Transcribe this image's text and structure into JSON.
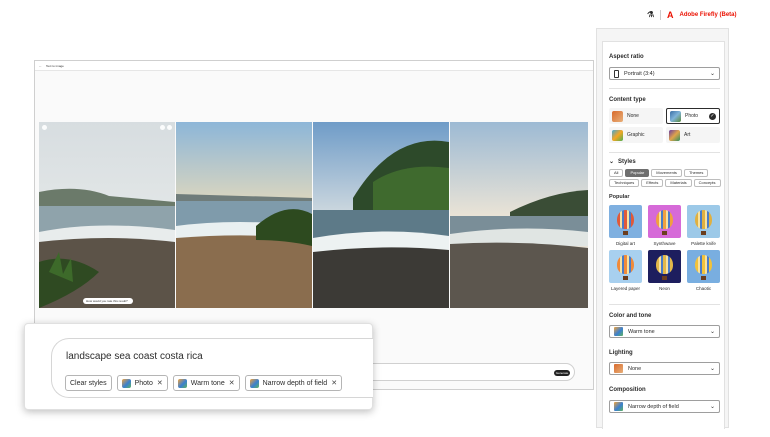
{
  "brand": {
    "name": "Adobe Firefly (Beta)",
    "accent": "#eb1000"
  },
  "topline": {
    "back": "Text to image"
  },
  "gallery": {
    "rating_text": "How would you rate this result?"
  },
  "bottom": {
    "generate": "Generate"
  },
  "prompt": {
    "text": "landscape sea coast costa rica",
    "chips": [
      {
        "label": "Clear styles",
        "thumb": false
      },
      {
        "label": "Photo",
        "thumb": true
      },
      {
        "label": "Warm tone",
        "thumb": true
      },
      {
        "label": "Narrow depth of field",
        "thumb": true
      }
    ]
  },
  "panel": {
    "aspect_ratio": {
      "title": "Aspect ratio",
      "value": "Portrait (3:4)"
    },
    "content_type": {
      "title": "Content type",
      "options": [
        {
          "label": "None",
          "icon": "none"
        },
        {
          "label": "Photo",
          "icon": "photo",
          "selected": true
        },
        {
          "label": "Graphic",
          "icon": "graphic"
        },
        {
          "label": "Art",
          "icon": "art"
        }
      ]
    },
    "styles": {
      "title": "Styles",
      "tabs": [
        {
          "label": "All"
        },
        {
          "label": "Popular",
          "active": true
        },
        {
          "label": "Movements"
        },
        {
          "label": "Themes"
        },
        {
          "label": "Techniques"
        },
        {
          "label": "Effects"
        },
        {
          "label": "Materials"
        },
        {
          "label": "Concepts"
        }
      ],
      "popular_title": "Popular",
      "items": [
        {
          "label": "Digital art",
          "bg": "#7fb0e0",
          "balloon": "#e05a3a"
        },
        {
          "label": "Synthwave",
          "bg": "#d66ad8",
          "balloon": "#f0a040"
        },
        {
          "label": "Palette knife",
          "bg": "#9cc9e8",
          "balloon": "#e0b040"
        },
        {
          "label": "Layered paper",
          "bg": "#a8d0ef",
          "balloon": "#f08a3a"
        },
        {
          "label": "Neon",
          "bg": "#1d1e5e",
          "balloon": "#e2b84a"
        },
        {
          "label": "Chaotic",
          "bg": "#79aee0",
          "balloon": "#f2c23a"
        }
      ]
    },
    "color_tone": {
      "title": "Color and tone",
      "value": "Warm tone"
    },
    "lighting": {
      "title": "Lighting",
      "value": "None"
    },
    "composition": {
      "title": "Composition",
      "value": "Narrow depth of field"
    }
  }
}
